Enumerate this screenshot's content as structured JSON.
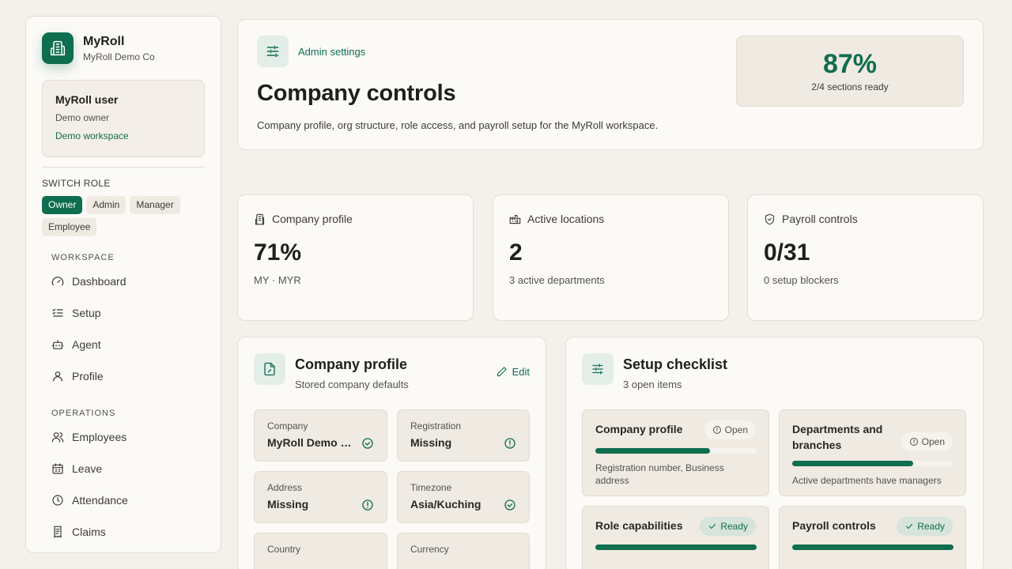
{
  "brand": {
    "name": "MyRoll",
    "company": "MyRoll Demo Co",
    "icon": "building-icon"
  },
  "user": {
    "name": "MyRoll user",
    "role": "Demo owner",
    "workspace": "Demo workspace"
  },
  "switch_role": {
    "label": "SWITCH ROLE",
    "roles": [
      "Owner",
      "Admin",
      "Manager",
      "Employee"
    ],
    "active": "Owner"
  },
  "nav": {
    "workspace_label": "WORKSPACE",
    "workspace_items": [
      {
        "label": "Dashboard",
        "icon": "gauge-icon"
      },
      {
        "label": "Setup",
        "icon": "checklist-icon"
      },
      {
        "label": "Agent",
        "icon": "bot-icon"
      },
      {
        "label": "Profile",
        "icon": "user-icon"
      }
    ],
    "operations_label": "OPERATIONS",
    "operations_items": [
      {
        "label": "Employees",
        "icon": "users-icon"
      },
      {
        "label": "Leave",
        "icon": "calendar-icon"
      },
      {
        "label": "Attendance",
        "icon": "clock-icon"
      },
      {
        "label": "Claims",
        "icon": "receipt-icon"
      }
    ]
  },
  "header": {
    "eyebrow": "Admin settings",
    "title": "Company controls",
    "description": "Company profile, org structure, role access, and payroll setup for the MyRoll workspace.",
    "progress_value": "87%",
    "progress_sub": "2/4 sections ready"
  },
  "stats": [
    {
      "label": "Company profile",
      "value": "71%",
      "note": "MY · MYR",
      "icon": "building-icon"
    },
    {
      "label": "Active locations",
      "value": "2",
      "note": "3 active departments",
      "icon": "factory-icon"
    },
    {
      "label": "Payroll controls",
      "value": "0/31",
      "note": "0 setup blockers",
      "icon": "shield-icon"
    }
  ],
  "profile_panel": {
    "title": "Company profile",
    "subtitle": "Stored company defaults",
    "edit_label": "Edit",
    "fields": [
      {
        "label": "Company",
        "value": "MyRoll Demo Co",
        "status": "ok"
      },
      {
        "label": "Registration",
        "value": "Missing",
        "status": "warn"
      },
      {
        "label": "Address",
        "value": "Missing",
        "status": "warn"
      },
      {
        "label": "Timezone",
        "value": "Asia/Kuching",
        "status": "ok"
      },
      {
        "label": "Country",
        "value": "",
        "status": ""
      },
      {
        "label": "Currency",
        "value": "",
        "status": ""
      }
    ]
  },
  "checklist_panel": {
    "title": "Setup checklist",
    "subtitle": "3 open items",
    "items": [
      {
        "title": "Company profile",
        "status": "Open",
        "progress": 0.71,
        "note": "Registration number, Business address"
      },
      {
        "title": "Departments and branches",
        "status": "Open",
        "progress": 0.75,
        "note": "Active departments have managers"
      },
      {
        "title": "Role capabilities",
        "status": "Ready",
        "progress": 1.0,
        "note": ""
      },
      {
        "title": "Payroll controls",
        "status": "Ready",
        "progress": 1.0,
        "note": ""
      }
    ]
  },
  "colors": {
    "accent": "#0f6e4f",
    "background": "#f4f0ea",
    "card": "#fbfaf7"
  }
}
